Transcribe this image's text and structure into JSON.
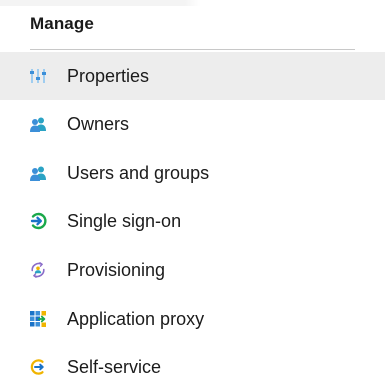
{
  "manage": {
    "header": "Manage",
    "items": [
      {
        "label": "Properties",
        "icon": "properties-icon",
        "selected": true
      },
      {
        "label": "Owners",
        "icon": "owners-icon",
        "selected": false
      },
      {
        "label": "Users and groups",
        "icon": "users-groups-icon",
        "selected": false
      },
      {
        "label": "Single sign-on",
        "icon": "single-sign-on-icon",
        "selected": false
      },
      {
        "label": "Provisioning",
        "icon": "provisioning-icon",
        "selected": false
      },
      {
        "label": "Application proxy",
        "icon": "application-proxy-icon",
        "selected": false
      },
      {
        "label": "Self-service",
        "icon": "self-service-icon",
        "selected": false
      }
    ]
  },
  "colors": {
    "selected_background": "#ededed",
    "text": "#1b1b1b",
    "icon_blue": "#3c8fd8",
    "icon_teal": "#2aa3c4",
    "icon_green": "#1aa84a",
    "icon_yellow": "#f0b400"
  }
}
